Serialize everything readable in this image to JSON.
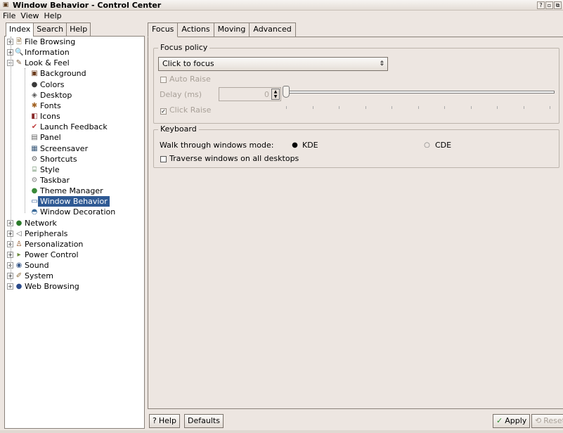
{
  "window": {
    "title": "Window Behavior - Control Center",
    "app_icon": "kde-control-center-icon"
  },
  "title_buttons": [
    "?",
    "▫",
    "⧉"
  ],
  "menubar": [
    "File",
    "View",
    "Help"
  ],
  "left_tabs": [
    "Index",
    "Search",
    "Help"
  ],
  "tree": [
    {
      "label": "File Browsing",
      "icon": "folder-icon",
      "glyph": "🗎",
      "color": "#8a6a3a",
      "level": 0,
      "expander": "+"
    },
    {
      "label": "Information",
      "icon": "info-icon",
      "glyph": "🔍",
      "color": "#2a4a8a",
      "level": 0,
      "expander": "+"
    },
    {
      "label": "Look & Feel",
      "icon": "paintbrush-icon",
      "glyph": "✎",
      "color": "#7a5a3a",
      "level": 0,
      "expander": "−"
    },
    {
      "label": "Background",
      "icon": "background-icon",
      "glyph": "▣",
      "color": "#6a3a1a",
      "level": 1
    },
    {
      "label": "Colors",
      "icon": "colors-icon",
      "glyph": "●",
      "color": "#3a3a3a",
      "level": 1
    },
    {
      "label": "Desktop",
      "icon": "desktop-icon",
      "glyph": "◈",
      "color": "#555555",
      "level": 1
    },
    {
      "label": "Fonts",
      "icon": "fonts-icon",
      "glyph": "✱",
      "color": "#a06020",
      "level": 1
    },
    {
      "label": "Icons",
      "icon": "icons-icon",
      "glyph": "◧",
      "color": "#8a2a2a",
      "level": 1
    },
    {
      "label": "Launch Feedback",
      "icon": "launch-feedback-icon",
      "glyph": "✔",
      "color": "#c04040",
      "level": 1
    },
    {
      "label": "Panel",
      "icon": "panel-icon",
      "glyph": "▤",
      "color": "#666666",
      "level": 1
    },
    {
      "label": "Screensaver",
      "icon": "screensaver-icon",
      "glyph": "▦",
      "color": "#3a5a7a",
      "level": 1
    },
    {
      "label": "Shortcuts",
      "icon": "shortcuts-icon",
      "glyph": "⚙",
      "color": "#666666",
      "level": 1
    },
    {
      "label": "Style",
      "icon": "style-icon",
      "glyph": "⌸",
      "color": "#3a6a3a",
      "level": 1
    },
    {
      "label": "Taskbar",
      "icon": "taskbar-icon",
      "glyph": "⚙",
      "color": "#888888",
      "level": 1
    },
    {
      "label": "Theme Manager",
      "icon": "theme-manager-icon",
      "glyph": "●",
      "color": "#3a8a3a",
      "level": 1
    },
    {
      "label": "Window Behavior",
      "icon": "window-behavior-icon",
      "glyph": "▭",
      "color": "#ffffff",
      "level": 1,
      "selected": true
    },
    {
      "label": "Window Decoration",
      "icon": "window-decoration-icon",
      "glyph": "◓",
      "color": "#3a6a9a",
      "level": 1
    },
    {
      "label": "Network",
      "icon": "network-icon",
      "glyph": "●",
      "color": "#2a7a2a",
      "level": 0,
      "expander": "+"
    },
    {
      "label": "Peripherals",
      "icon": "peripherals-icon",
      "glyph": "◁",
      "color": "#666666",
      "level": 0,
      "expander": "+"
    },
    {
      "label": "Personalization",
      "icon": "personalization-icon",
      "glyph": "♙",
      "color": "#8a4a1a",
      "level": 0,
      "expander": "+"
    },
    {
      "label": "Power Control",
      "icon": "power-icon",
      "glyph": "▸",
      "color": "#6a8a3a",
      "level": 0,
      "expander": "+"
    },
    {
      "label": "Sound",
      "icon": "sound-icon",
      "glyph": "◉",
      "color": "#3a5a8a",
      "level": 0,
      "expander": "+"
    },
    {
      "label": "System",
      "icon": "system-icon",
      "glyph": "✐",
      "color": "#8a6a3a",
      "level": 0,
      "expander": "+"
    },
    {
      "label": "Web Browsing",
      "icon": "web-browsing-icon",
      "glyph": "●",
      "color": "#2a4a8a",
      "level": 0,
      "expander": "+"
    }
  ],
  "right_tabs": [
    "Focus",
    "Actions",
    "Moving",
    "Advanced"
  ],
  "focus": {
    "group_title": "Focus policy",
    "policy_value": "Click to focus",
    "auto_raise": "Auto Raise",
    "delay_label": "Delay (ms)",
    "delay_value": "0",
    "click_raise": "Click Raise",
    "click_raise_checked": true
  },
  "keyboard": {
    "group_title": "Keyboard",
    "walk_label": "Walk through windows mode:",
    "mode_kde": "KDE",
    "mode_cde": "CDE",
    "selected_mode": "KDE",
    "traverse_label": "Traverse windows on all desktops"
  },
  "buttons": {
    "help": "Help",
    "defaults": "Defaults",
    "apply": "Apply",
    "reset": "Reset"
  },
  "colors": {
    "selection": "#2f5a94",
    "window_bg": "#ede6e1"
  }
}
